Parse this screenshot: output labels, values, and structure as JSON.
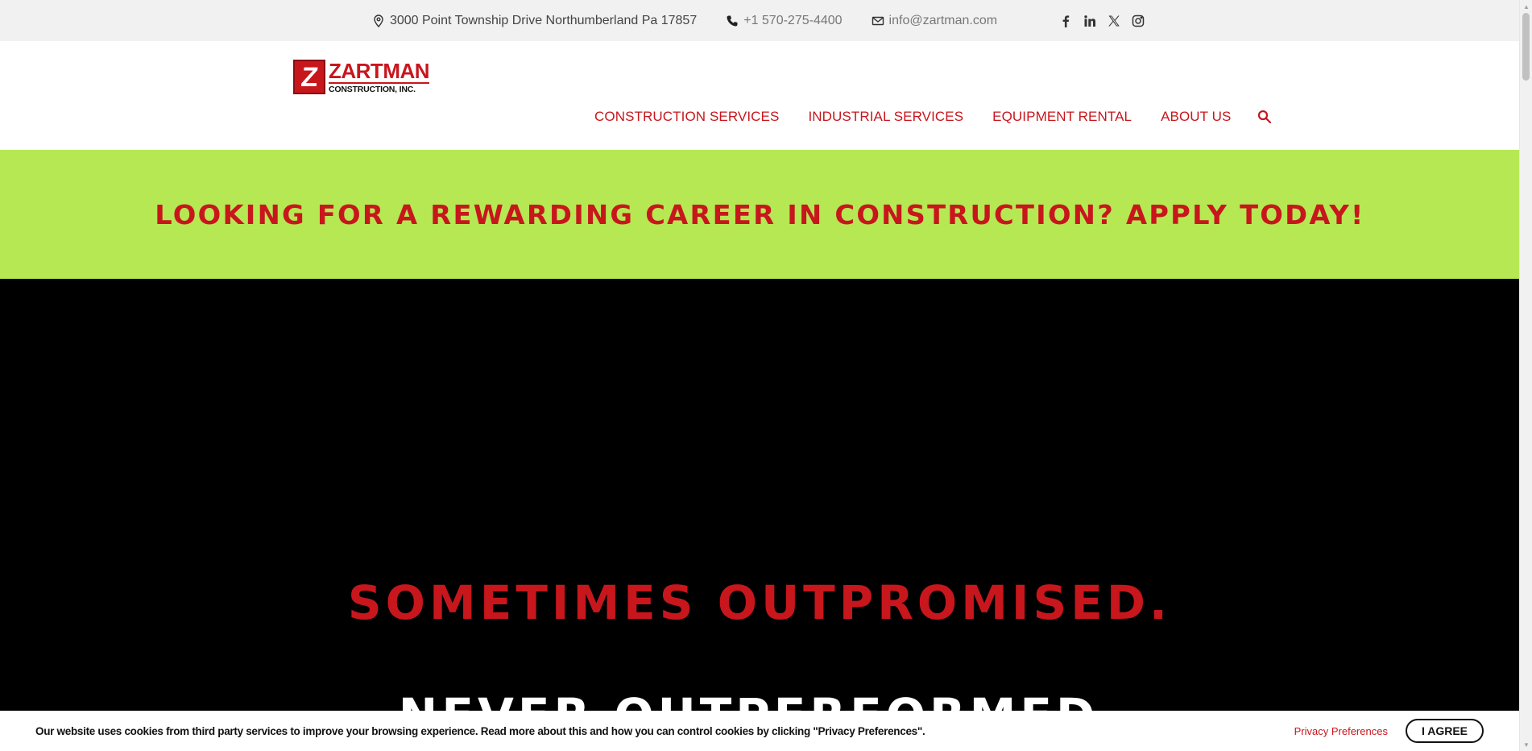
{
  "topbar": {
    "address": "3000 Point Township Drive Northumberland Pa 17857",
    "phone": "+1 570-275-4400",
    "email": "info@zartman.com",
    "social_icons": [
      "facebook-icon",
      "linkedin-icon",
      "x-icon",
      "instagram-icon"
    ]
  },
  "logo": {
    "mark": "Z",
    "name": "ZARTMAN",
    "sub": "CONSTRUCTION, INC."
  },
  "nav": {
    "items": [
      {
        "label": "CONSTRUCTION SERVICES"
      },
      {
        "label": "INDUSTRIAL SERVICES"
      },
      {
        "label": "EQUIPMENT RENTAL"
      },
      {
        "label": "ABOUT US"
      }
    ],
    "search_icon": "search-icon"
  },
  "banner": {
    "text": "LOOKING FOR A REWARDING CAREER IN CONSTRUCTION? APPLY TODAY!"
  },
  "hero": {
    "line1": "SOMETIMES OUTPROMISED.",
    "line2": "NEVER OUTPERFORMED."
  },
  "cookie": {
    "text": "Our website uses cookies from third party services to improve your browsing experience. Read more about this and how you can control cookies by clicking \"Privacy Preferences\".",
    "privacy_label": "Privacy Preferences",
    "agree_label": "I AGREE"
  },
  "colors": {
    "brand_red": "#c8161d",
    "banner_green": "#b5e853",
    "hero_bg": "#000000",
    "topbar_bg": "#f1f1f2"
  }
}
